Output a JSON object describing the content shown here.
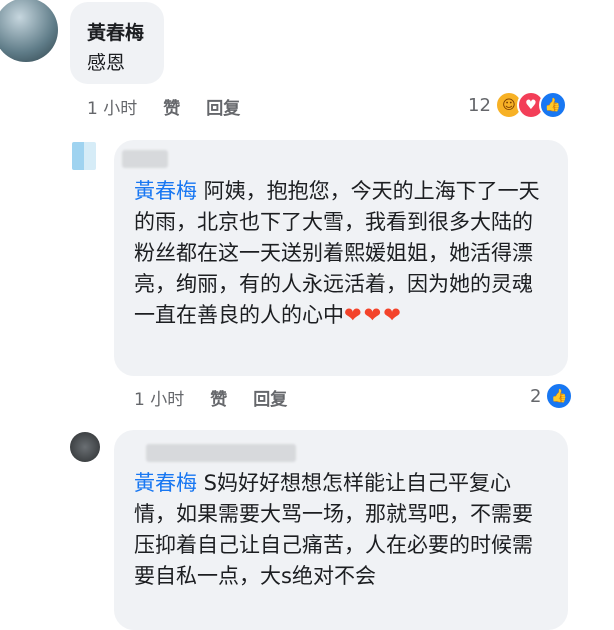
{
  "comment1": {
    "author": "黃春梅",
    "text": "感恩",
    "time": "1 小时",
    "like_label": "赞",
    "reply_label": "回复",
    "reaction_count": "12",
    "reactions": [
      "care-icon",
      "love-icon",
      "like-icon"
    ]
  },
  "reply1": {
    "mention": "黃春梅",
    "text": " 阿姨，抱抱您，今天的上海下了一天的雨，北京也下了大雪，我看到很多大陆的粉丝都在这一天送别着熙媛姐姐，她活得漂亮，绚丽，有的人永远活着，因为她的灵魂一直在善良的人的心中",
    "hearts": "❤❤❤",
    "time": "1 小时",
    "like_label": "赞",
    "reply_label": "回复",
    "reaction_count": "2"
  },
  "reply2": {
    "mention": "黃春梅",
    "text": " S妈好好想想怎样能让自己平复心情，如果需要大骂一场，那就骂吧，不需要压抑着自己让自己痛苦，人在必要的时候需要自私一点，大s绝对不会"
  },
  "colors": {
    "accent": "#1877f2",
    "bubble": "#f0f2f5",
    "meta": "#65676b"
  }
}
